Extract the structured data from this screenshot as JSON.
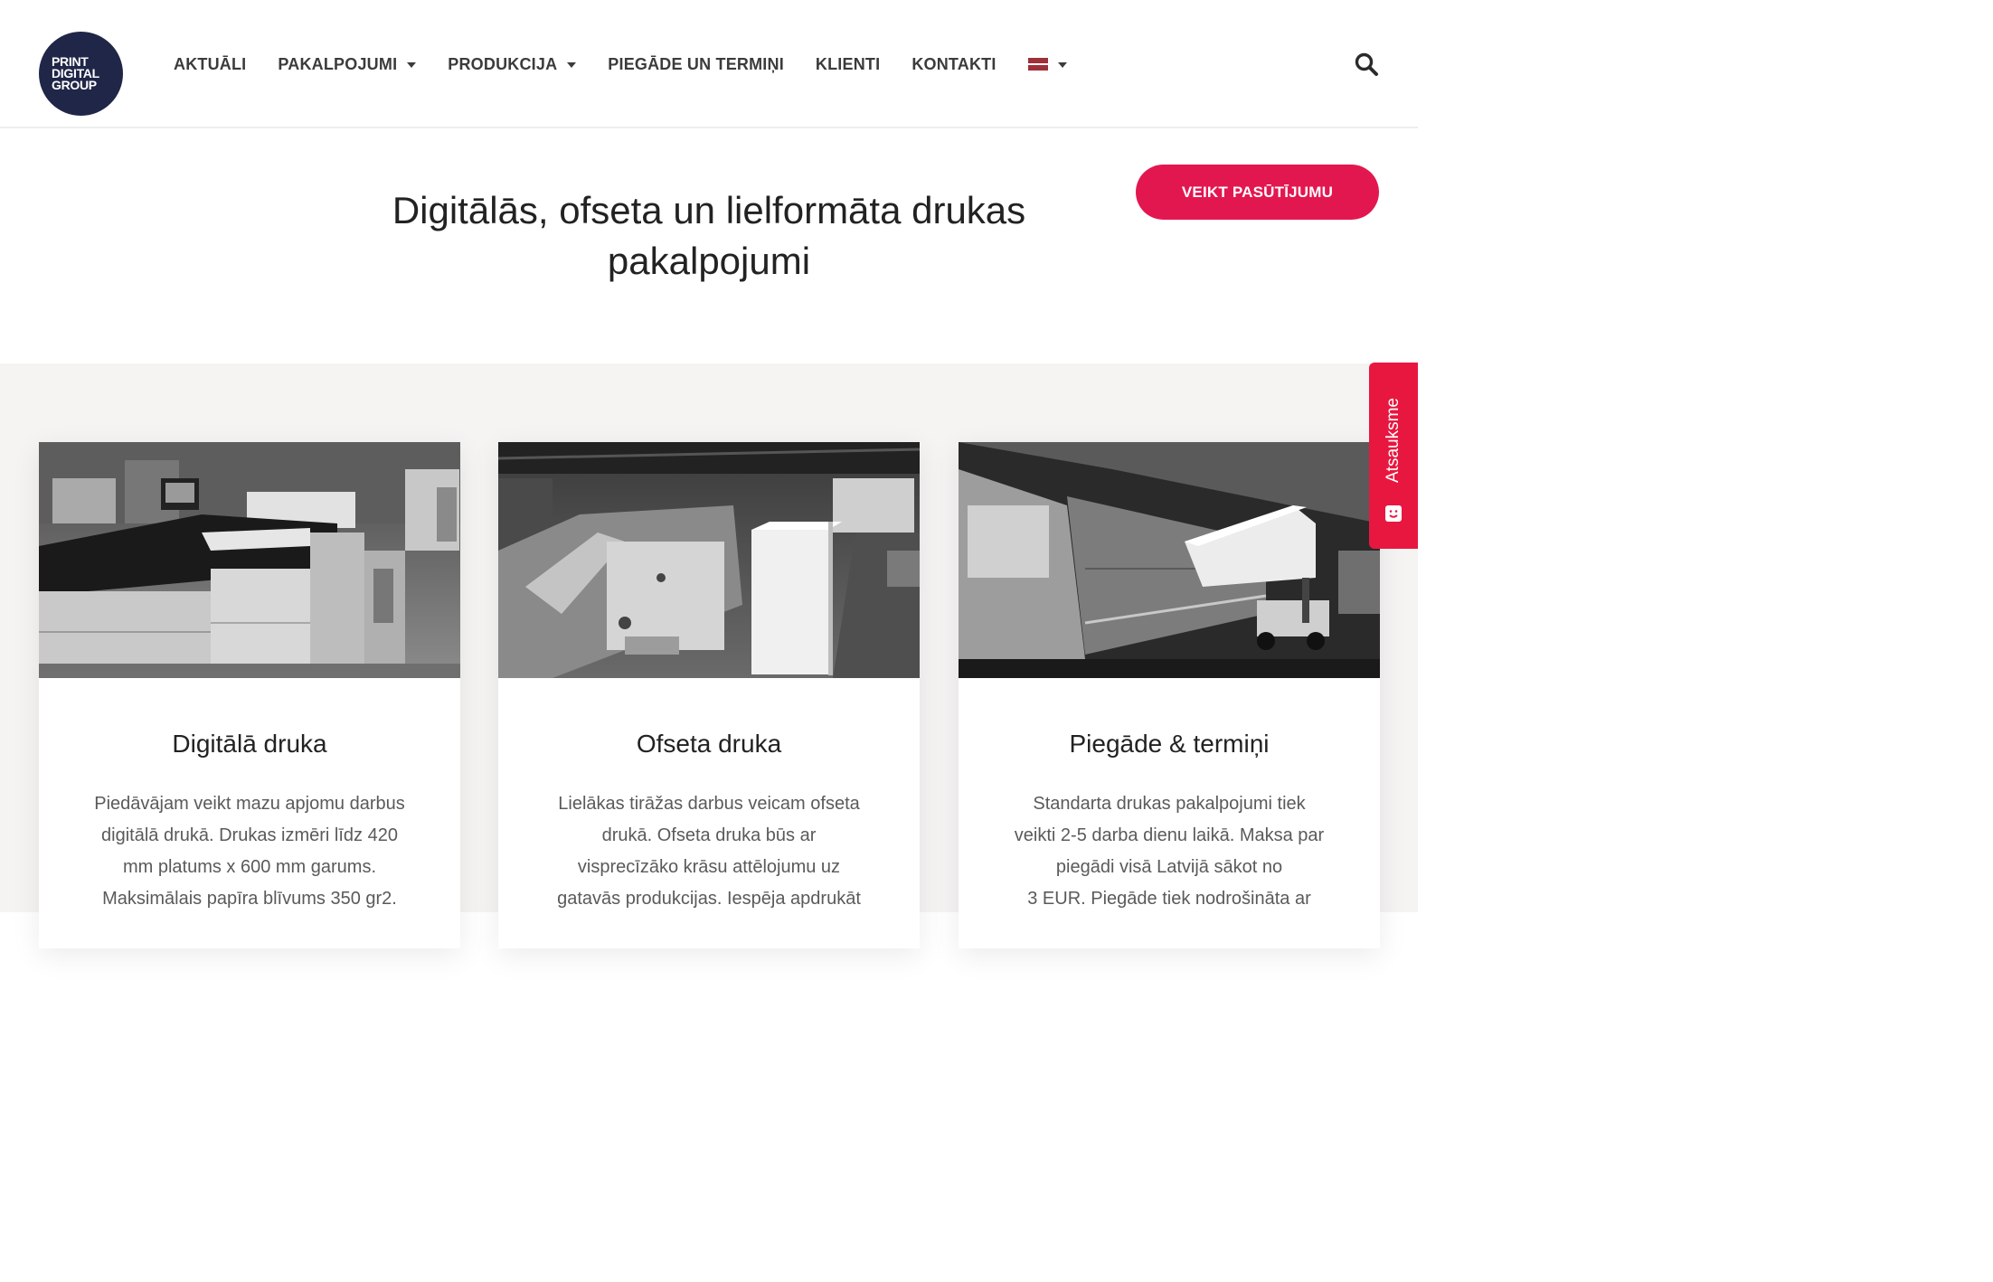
{
  "logo": {
    "line1": "PRINT",
    "line2": "DIGITAL",
    "line3": "GROUP"
  },
  "nav": {
    "items": [
      {
        "label": "AKTUĀLI",
        "dropdown": false
      },
      {
        "label": "PAKALPOJUMI",
        "dropdown": true
      },
      {
        "label": "PRODUKCIJA",
        "dropdown": true
      },
      {
        "label": "PIEGĀDE UN TERMIŅI",
        "dropdown": false
      },
      {
        "label": "KLIENTI",
        "dropdown": false
      },
      {
        "label": "KONTAKTI",
        "dropdown": false
      }
    ],
    "language_icon": "latvia-flag-icon"
  },
  "hero": {
    "title_line1": "Digitālās, ofseta un lielformāta drukas",
    "title_line2": "pakalpojumi",
    "order_button": "VEIKT PASŪTĪJUMU"
  },
  "cards": [
    {
      "title": "Digitālā druka",
      "lines": [
        "Piedāvājam veikt mazu apjomu darbus",
        "digitālā drukā. Drukas izmēri līdz 420",
        "mm platums x 600 mm garums.",
        "Maksimālais papīra blīvums 350 gr2."
      ]
    },
    {
      "title": "Ofseta druka",
      "lines": [
        "Lielākas tirāžas darbus veicam ofseta",
        "drukā. Ofseta druka būs ar",
        "visprecīzāko krāsu attēlojumu uz",
        "gatavās produkcijas. Iespēja apdrukāt"
      ]
    },
    {
      "title": "Piegāde & termiņi",
      "lines": [
        "Standarta drukas pakalpojumi tiek",
        "veikti 2-5 darba dienu laikā. Maksa par",
        "piegādi visā Latvijā sākot no",
        "3 EUR. Piegāde tiek nodrošināta ar"
      ]
    }
  ],
  "feedback": {
    "label": "Atsauksme"
  },
  "colors": {
    "accent": "#e3174f",
    "logo_bg": "#1f2647",
    "section_bg": "#f5f4f3"
  }
}
